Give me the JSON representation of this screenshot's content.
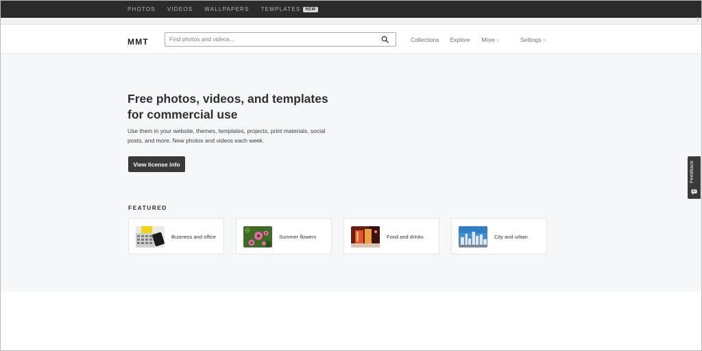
{
  "topbar": {
    "links": [
      {
        "label": "PHOTOS"
      },
      {
        "label": "VIDEOS"
      },
      {
        "label": "WALLPAPERS"
      },
      {
        "label": "TEMPLATES",
        "badge": "NEW"
      }
    ],
    "close_glyph": "?"
  },
  "header": {
    "logo": "MMT",
    "search": {
      "placeholder": "Find photos and videos...",
      "value": "",
      "icon": "search-icon"
    },
    "nav": [
      {
        "label": "Collections",
        "dropdown": false
      },
      {
        "label": "Explore",
        "dropdown": false
      },
      {
        "label": "More",
        "dropdown": true
      },
      {
        "label": "Settings",
        "dropdown": true
      }
    ]
  },
  "hero": {
    "title": "Free photos, videos, and templates for commercial use",
    "subtitle": "Use them in your website, themes, templates, projects, print materials, social posts, and more. New photos and videos each week.",
    "button_label": "View license info"
  },
  "featured": {
    "heading": "FEATURED",
    "cards": [
      {
        "label": "Business and office"
      },
      {
        "label": "Summer flowers"
      },
      {
        "label": "Food and drinks"
      },
      {
        "label": "City and urban"
      }
    ]
  },
  "feedback": {
    "label": "Feedback",
    "icon": "feedback-chat-icon"
  },
  "colors": {
    "topbar_bg": "#2b2b2b",
    "hero_bg": "#f6f7f9",
    "button_bg": "#3a3839",
    "text_dark": "#2f2e33"
  }
}
